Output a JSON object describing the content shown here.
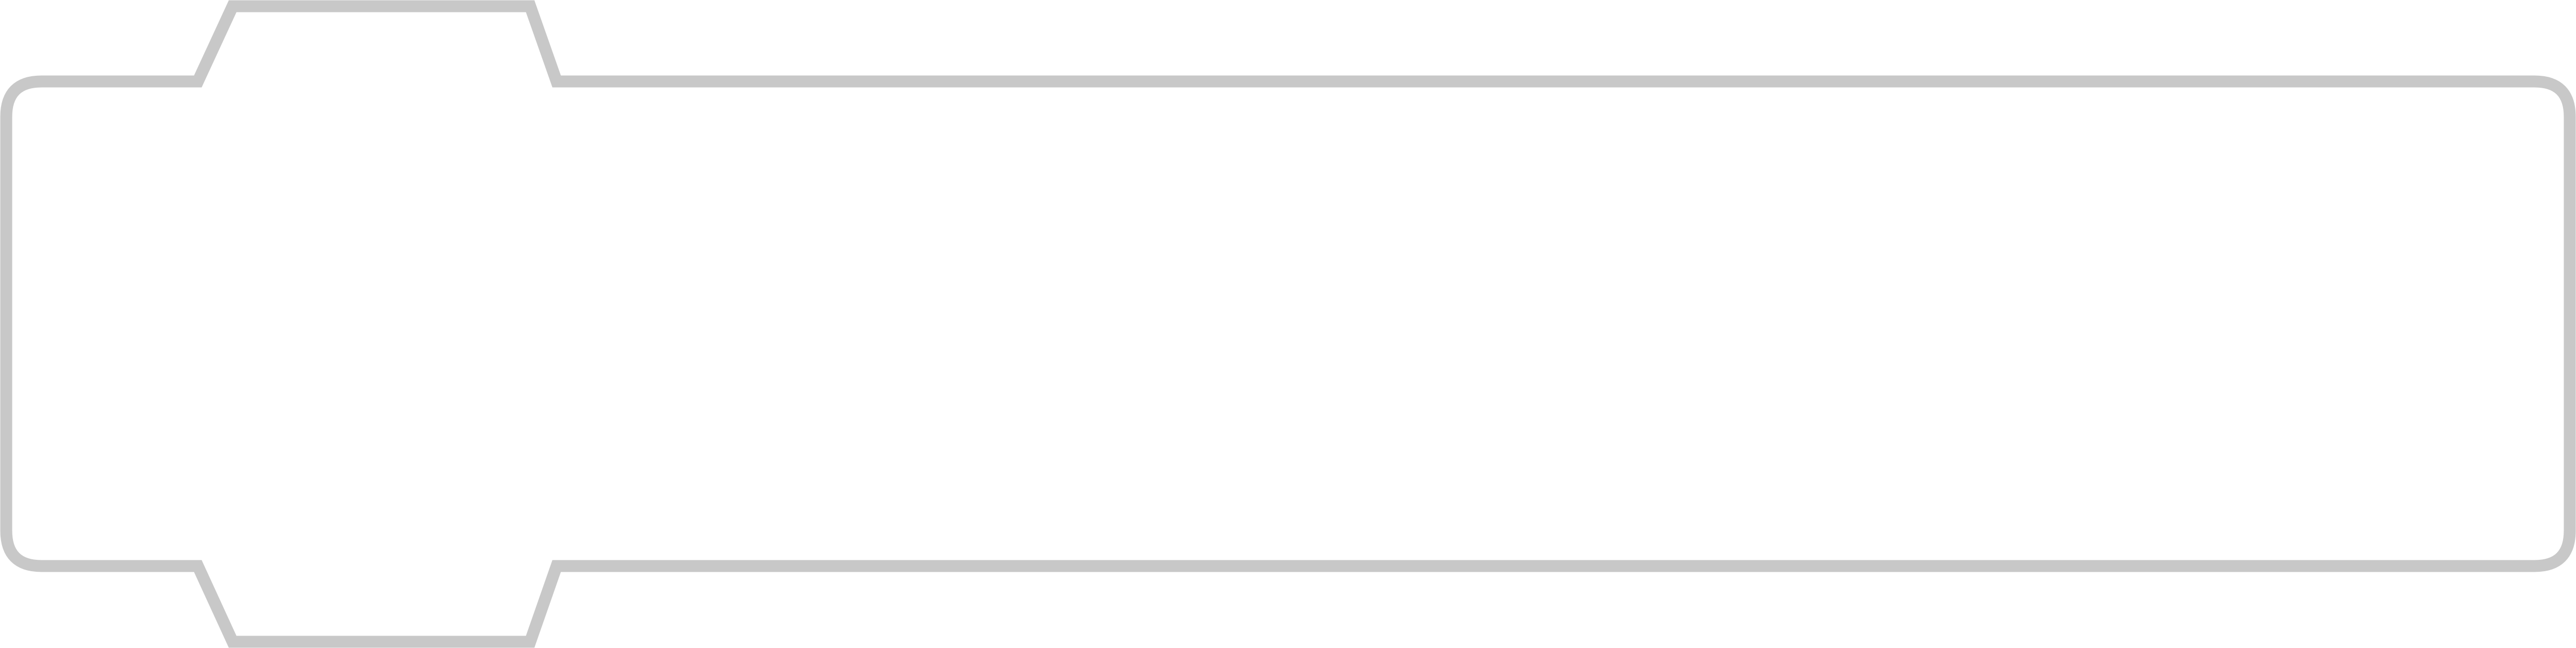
{
  "frame": {
    "outline_color": "#c8c8c8",
    "fill_color": "#ffffff"
  }
}
